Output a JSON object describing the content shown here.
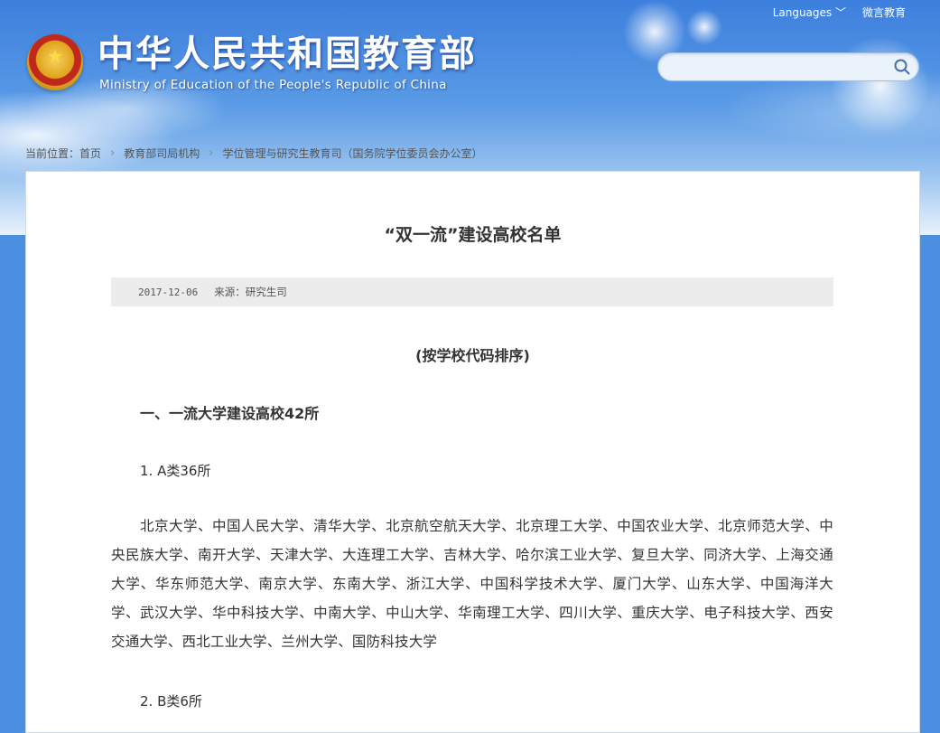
{
  "topbar": {
    "languages": "Languages ﹀",
    "wechat": "微言教育"
  },
  "header": {
    "title": "中华人民共和国教育部",
    "subtitle": "Ministry of Education of the People's Republic of China"
  },
  "search": {
    "placeholder": ""
  },
  "breadcrumb": {
    "prefix": "当前位置：",
    "items": [
      "首页",
      "教育部司局机构",
      "学位管理与研究生教育司（国务院学位委员会办公室）"
    ]
  },
  "article": {
    "title": "“双一流”建设高校名单",
    "date": "2017-12-06",
    "source": "来源：研究生司",
    "order_note": "(按学校代码排序)",
    "section1_heading": "一、一流大学建设高校42所",
    "sub_a": "1. A类36所",
    "list_a": "北京大学、中国人民大学、清华大学、北京航空航天大学、北京理工大学、中国农业大学、北京师范大学、中央民族大学、南开大学、天津大学、大连理工大学、吉林大学、哈尔滨工业大学、复旦大学、同济大学、上海交通大学、华东师范大学、南京大学、东南大学、浙江大学、中国科学技术大学、厦门大学、山东大学、中国海洋大学、武汉大学、华中科技大学、中南大学、中山大学、华南理工大学、四川大学、重庆大学、电子科技大学、西安交通大学、西北工业大学、兰州大学、国防科技大学",
    "sub_b": "2. B类6所"
  },
  "icons": {
    "emblem": "national-emblem-icon",
    "search": "search-icon",
    "chevron": "chevron-right-icon"
  }
}
